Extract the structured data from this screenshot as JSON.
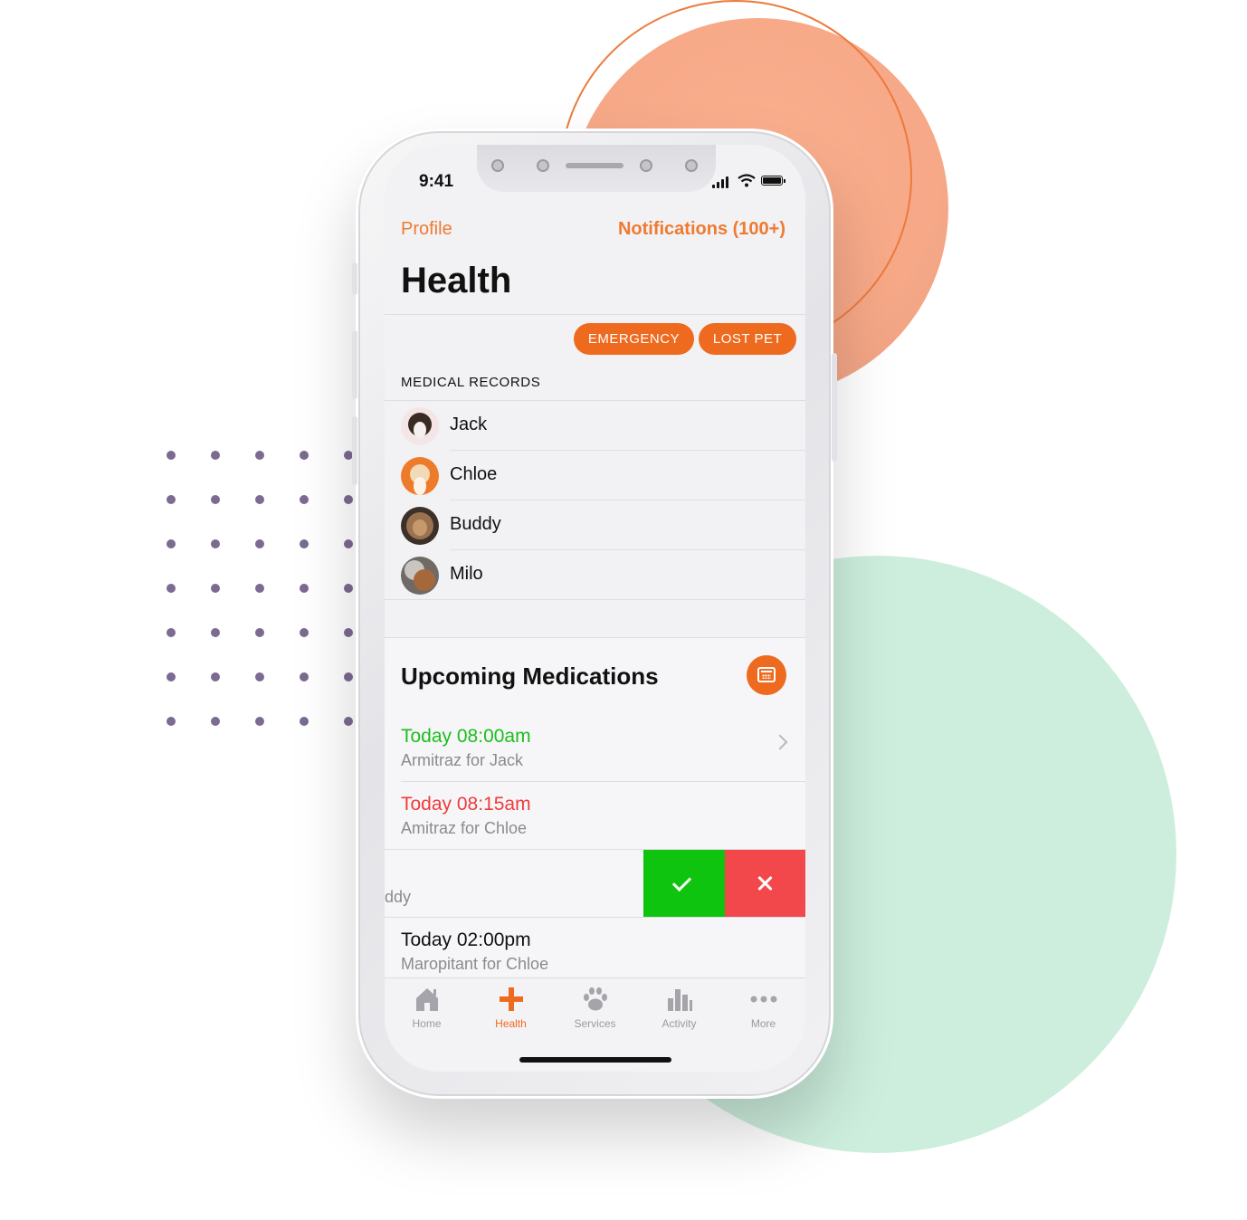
{
  "status": {
    "time": "9:41"
  },
  "nav": {
    "left": "Profile",
    "right": "Notifications (100+)"
  },
  "title": "Health",
  "actions": {
    "emergency": "EMERGENCY",
    "lost_pet": "LOST PET"
  },
  "medical_records": {
    "label": "MEDICAL RECORDS",
    "items": [
      {
        "name": "Jack"
      },
      {
        "name": "Chloe"
      },
      {
        "name": "Buddy"
      },
      {
        "name": "Milo"
      }
    ]
  },
  "medications": {
    "heading": "Upcoming Medications",
    "items": [
      {
        "time": "Today 08:00am",
        "desc": "Armitraz for Jack",
        "status_color": "#1bbf1b"
      },
      {
        "time": "Today 08:15am",
        "desc": "Amitraz for Chloe",
        "status_color": "#ef3b3b"
      },
      {
        "time": "",
        "desc": "ddy",
        "status_color": "#111111"
      },
      {
        "time": "Today 02:00pm",
        "desc": "Maropitant for Chloe",
        "status_color": "#111111"
      }
    ]
  },
  "tabs": [
    {
      "label": "Home",
      "icon": "home-icon"
    },
    {
      "label": "Health",
      "icon": "health-cross-icon"
    },
    {
      "label": "Services",
      "icon": "paw-icon"
    },
    {
      "label": "Activity",
      "icon": "bar-chart-icon"
    },
    {
      "label": "More",
      "icon": "more-dots-icon"
    }
  ],
  "colors": {
    "accent": "#ee6a1f",
    "confirm": "#0ec40e",
    "dismiss": "#f2484c"
  }
}
